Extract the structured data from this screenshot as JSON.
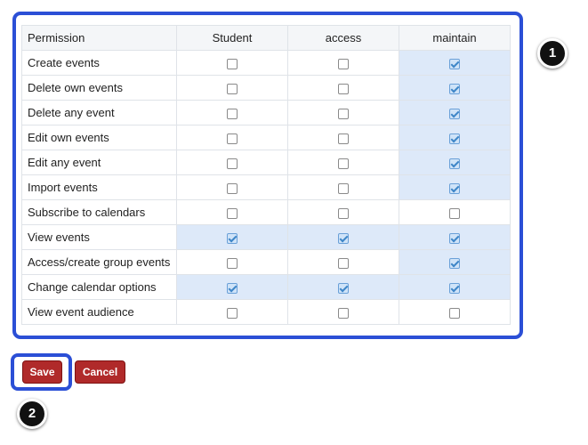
{
  "permissions_table": {
    "headers": [
      "Permission",
      "Student",
      "access",
      "maintain"
    ],
    "rows": [
      {
        "label": "Create events",
        "values": [
          false,
          false,
          true
        ]
      },
      {
        "label": "Delete own events",
        "values": [
          false,
          false,
          true
        ]
      },
      {
        "label": "Delete any event",
        "values": [
          false,
          false,
          true
        ]
      },
      {
        "label": "Edit own events",
        "values": [
          false,
          false,
          true
        ]
      },
      {
        "label": "Edit any event",
        "values": [
          false,
          false,
          true
        ]
      },
      {
        "label": "Import events",
        "values": [
          false,
          false,
          true
        ]
      },
      {
        "label": "Subscribe to calendars",
        "values": [
          false,
          false,
          false
        ]
      },
      {
        "label": "View events",
        "values": [
          true,
          true,
          true
        ]
      },
      {
        "label": "Access/create group events",
        "values": [
          false,
          false,
          true
        ]
      },
      {
        "label": "Change calendar options",
        "values": [
          true,
          true,
          true
        ]
      },
      {
        "label": "View event audience",
        "values": [
          false,
          false,
          false
        ]
      }
    ]
  },
  "actions": {
    "save_label": "Save",
    "cancel_label": "Cancel"
  },
  "callouts": {
    "table": "1",
    "save": "2"
  },
  "colors": {
    "highlight_border": "#2b4fd6",
    "checked_cell_bg": "#dde9f9",
    "button_bg": "#b02a2a",
    "callout_bg": "#111111"
  }
}
